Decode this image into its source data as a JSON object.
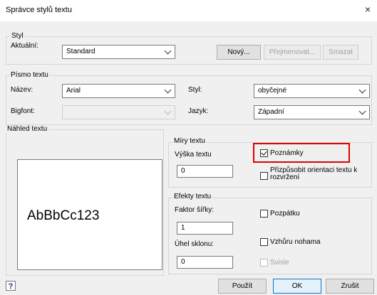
{
  "window": {
    "title": "Správce stylů textu",
    "close_glyph": "×"
  },
  "style_group": {
    "label": "Styl",
    "current_label": "Aktuální:",
    "current_value": "Standard",
    "new_button": "Nový...",
    "rename_button": "Přejmenovat...",
    "delete_button": "Smazat"
  },
  "font_group": {
    "label": "Písmo textu",
    "name_label": "Název:",
    "name_value": "Arial",
    "style_label": "Styl:",
    "style_value": "obyčejné",
    "bigfont_label": "Bigfont:",
    "bigfont_value": "",
    "language_label": "Jazyk:",
    "language_value": "Západní"
  },
  "preview_group": {
    "label": "Náhled textu",
    "sample": "AbBbCc123"
  },
  "sizes_group": {
    "label": "Míry textu",
    "height_label": "Výška textu",
    "height_value": "0",
    "annotative_label": "Poznámky",
    "annotative_checked": true,
    "orientation_label_line1": "Přizpůsobit orientaci textu k",
    "orientation_label_line2": "rozvržení",
    "orientation_checked": false
  },
  "effects_group": {
    "label": "Efekty textu",
    "width_factor_label": "Faktor šířky:",
    "width_factor_value": "1",
    "oblique_label": "Úhel sklonu:",
    "oblique_value": "0",
    "backwards_label": "Pozpátku",
    "upside_down_label": "Vzhůru nohama",
    "vertical_label": "Svisle"
  },
  "footer": {
    "help_glyph": "?",
    "apply_button": "Použít",
    "ok_button": "OK",
    "cancel_button": "Zrušit"
  },
  "colors": {
    "highlight_box": "#e00000",
    "default_button_border": "#0078d7"
  }
}
